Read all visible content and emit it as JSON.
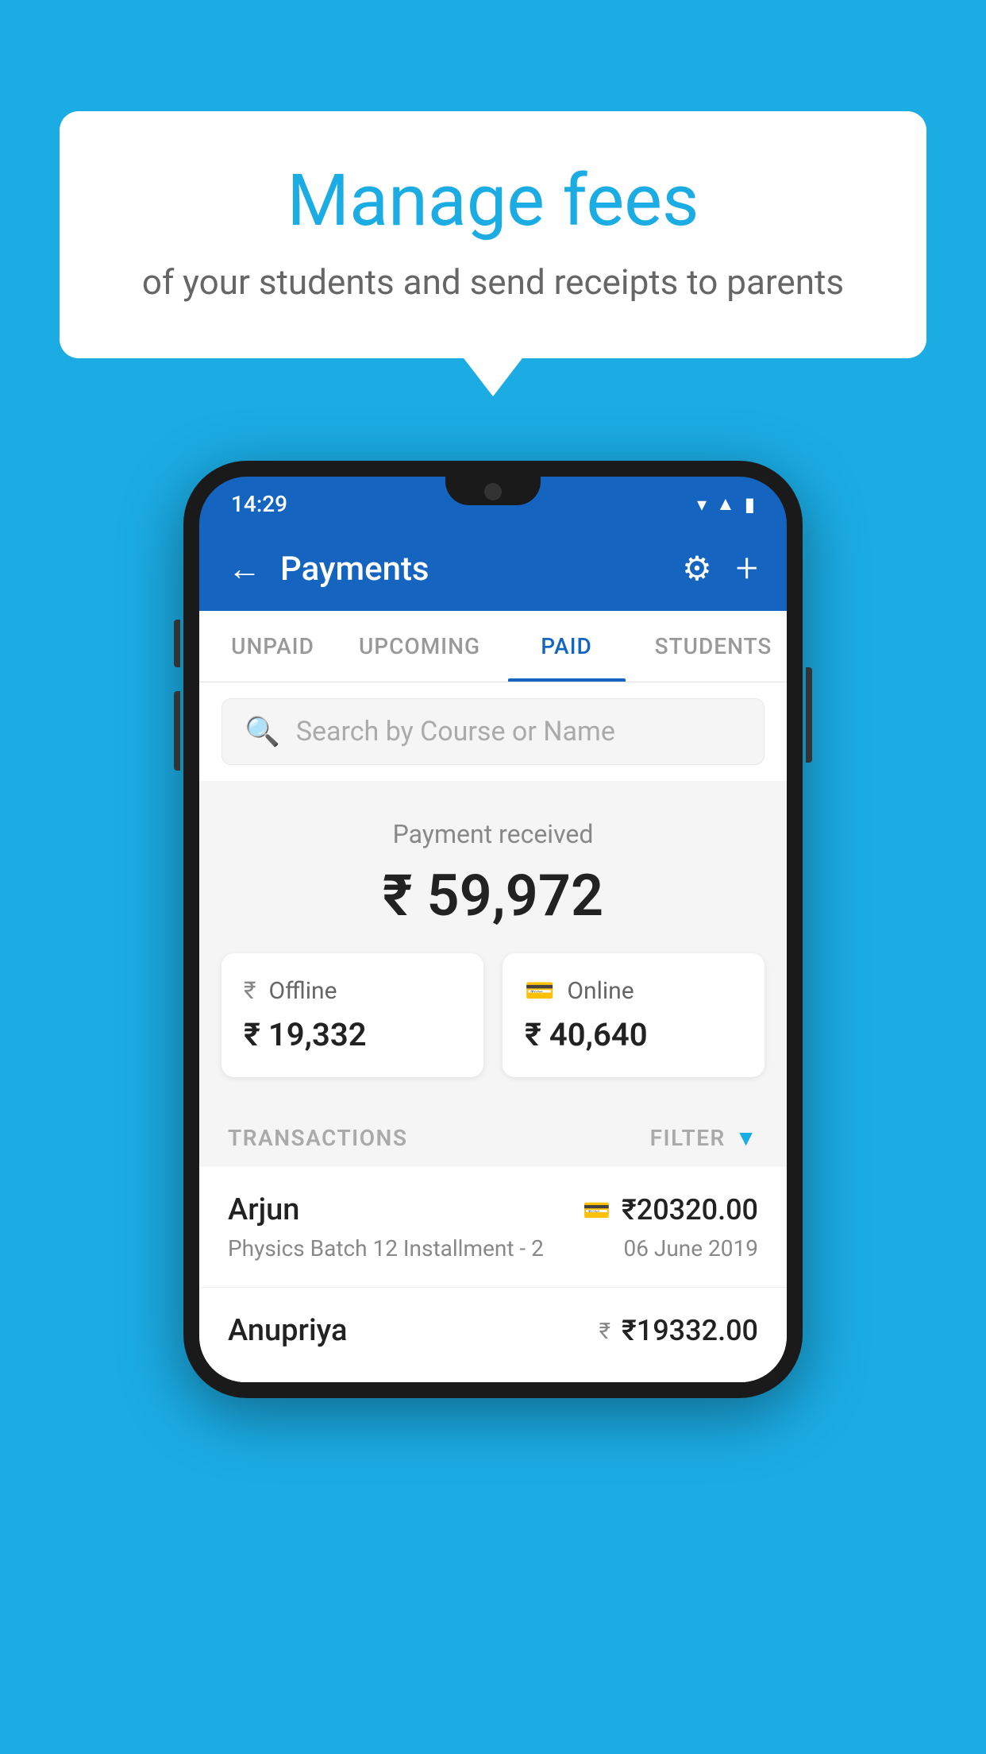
{
  "background_color": "#1BACE4",
  "speech_bubble": {
    "title": "Manage fees",
    "subtitle": "of your students and send receipts to parents"
  },
  "status_bar": {
    "time": "14:29",
    "icons": [
      "wifi",
      "signal",
      "battery"
    ]
  },
  "header": {
    "title": "Payments",
    "back_label": "←",
    "gear_icon": "⚙",
    "plus_icon": "+"
  },
  "tabs": [
    {
      "label": "UNPAID",
      "active": false
    },
    {
      "label": "UPCOMING",
      "active": false
    },
    {
      "label": "PAID",
      "active": true
    },
    {
      "label": "STUDENTS",
      "active": false
    }
  ],
  "search": {
    "placeholder": "Search by Course or Name"
  },
  "payment_summary": {
    "label": "Payment received",
    "total": "₹ 59,972",
    "offline": {
      "icon": "rupee",
      "type": "Offline",
      "amount": "₹ 19,332"
    },
    "online": {
      "icon": "card",
      "type": "Online",
      "amount": "₹ 40,640"
    }
  },
  "transactions": {
    "label": "TRANSACTIONS",
    "filter_label": "FILTER",
    "items": [
      {
        "name": "Arjun",
        "course": "Physics Batch 12 Installment - 2",
        "amount": "₹20320.00",
        "date": "06 June 2019",
        "payment_type": "card"
      },
      {
        "name": "Anupriya",
        "course": "",
        "amount": "₹19332.00",
        "date": "",
        "payment_type": "rupee"
      }
    ]
  }
}
